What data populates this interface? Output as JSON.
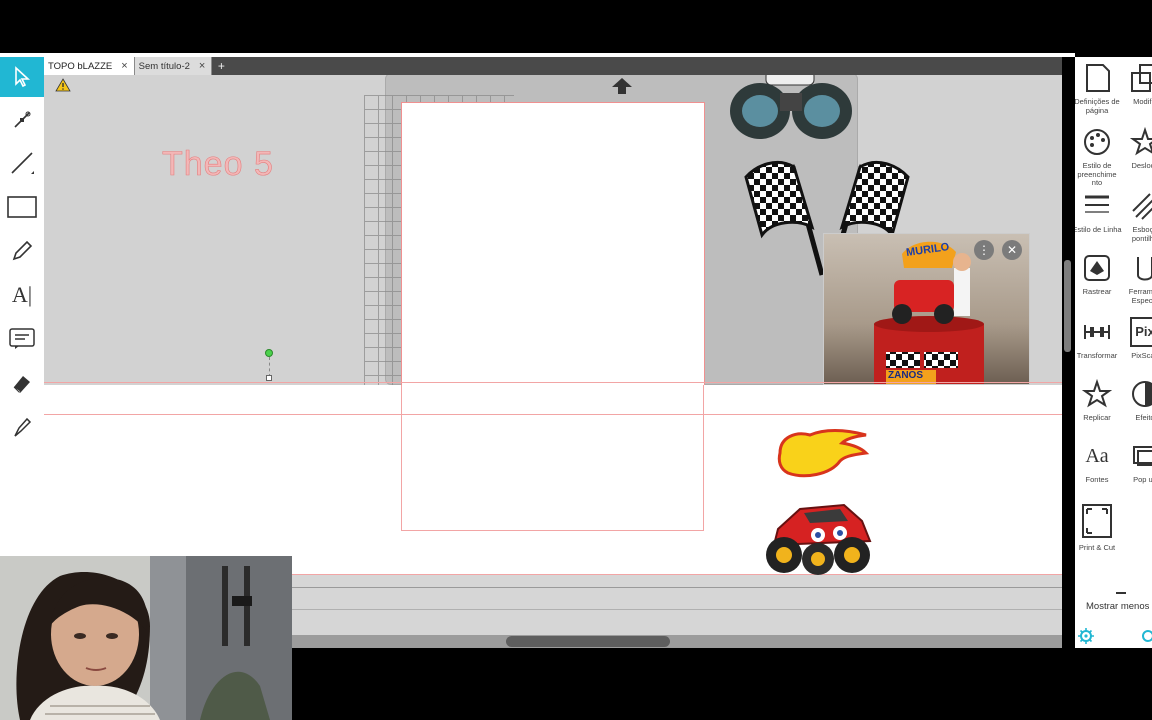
{
  "tabs": [
    {
      "label": "TOPO bLAZZE",
      "active": true,
      "close": "×"
    },
    {
      "label": "Sem título-2",
      "active": false,
      "close": "×"
    }
  ],
  "tab_add": "+",
  "canvas": {
    "text_object": "Theo 5",
    "photo_cake_text": "MURILO",
    "photo_cake_text2": "ZANOS"
  },
  "left_tools": [
    {
      "name": "select-tool",
      "icon": "arrow-pointer-icon",
      "selected": true
    },
    {
      "name": "point-edit-tool",
      "icon": "node-edit-icon"
    },
    {
      "name": "line-tool",
      "icon": "line-icon"
    },
    {
      "name": "rectangle-tool",
      "icon": "rectangle-icon"
    },
    {
      "name": "pencil-tool",
      "icon": "pencil-icon"
    },
    {
      "name": "text-tool",
      "icon": "text-icon",
      "label": "A|"
    },
    {
      "name": "text-box-tool",
      "icon": "text-box-icon"
    },
    {
      "name": "eraser-tool",
      "icon": "eraser-icon"
    },
    {
      "name": "knife-tool",
      "icon": "knife-icon"
    }
  ],
  "right_panel": {
    "col1": [
      {
        "label": "Definições de página"
      },
      {
        "label": "Estilo de preenchime nto"
      },
      {
        "label": "Estilo de Linha"
      },
      {
        "label": "Rastrear"
      },
      {
        "label": "Transformar"
      },
      {
        "label": "Replicar"
      },
      {
        "label": "Fontes"
      },
      {
        "label": "Print & Cut"
      }
    ],
    "col2": [
      {
        "label": "Modific"
      },
      {
        "label": "Desloca"
      },
      {
        "label": "Esboço pontilha"
      },
      {
        "label": "Ferramen Especia"
      },
      {
        "label": "PixScan"
      },
      {
        "label": "Efeito"
      },
      {
        "label": "Pop up"
      }
    ],
    "pix_label": "Pix",
    "show_less": "Mostrar menos"
  },
  "colors": {
    "accent": "#21b7d3",
    "tab_bar": "#4a4a4a",
    "canvas_gray": "#d2d2d2",
    "cut_line": "#f2a5a5",
    "text_object": "#f3b7b7"
  }
}
